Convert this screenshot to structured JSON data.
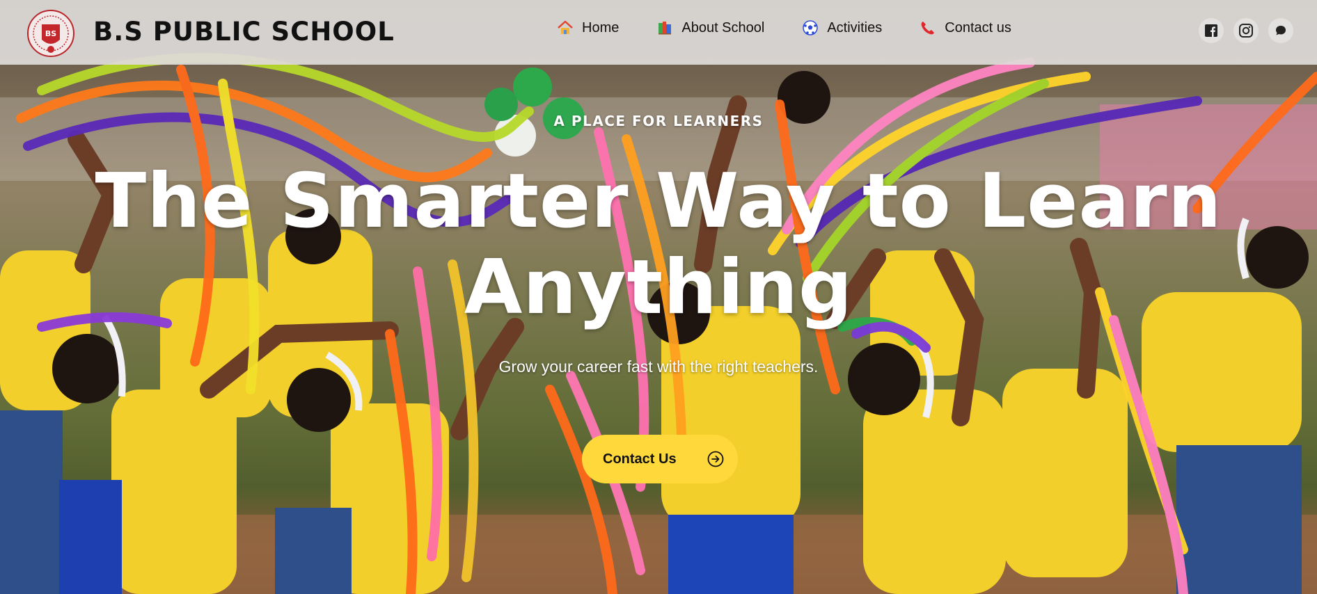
{
  "header": {
    "brand": "B.S PUBLIC SCHOOL",
    "logo": {
      "monogram": "BS",
      "ring_text": "B.S PUBLIC SCHOOL"
    },
    "nav": [
      {
        "label": "Home",
        "icon": "house-icon"
      },
      {
        "label": "About School",
        "icon": "books-icon"
      },
      {
        "label": "Activities",
        "icon": "soccer-ball-icon"
      },
      {
        "label": "Contact us",
        "icon": "phone-icon"
      }
    ],
    "social": [
      {
        "icon": "facebook-icon"
      },
      {
        "icon": "instagram-icon"
      },
      {
        "icon": "chat-bubble-icon"
      }
    ]
  },
  "hero": {
    "eyebrow": "A PLACE FOR LEARNERS",
    "headline_line1": "The Smarter Way to Learn",
    "headline_line2": "Anything",
    "subtitle": "Grow your career fast with the right teachers.",
    "cta_label": "Contact Us",
    "cta_icon": "arrow-circle-right-icon",
    "photo": "children in yellow shirts dancing with colorful ribbons"
  },
  "colors": {
    "header_bg": "#dedad8",
    "cta_bg": "#ffd93b",
    "text_dark": "#111111",
    "text_light": "#ffffff"
  }
}
